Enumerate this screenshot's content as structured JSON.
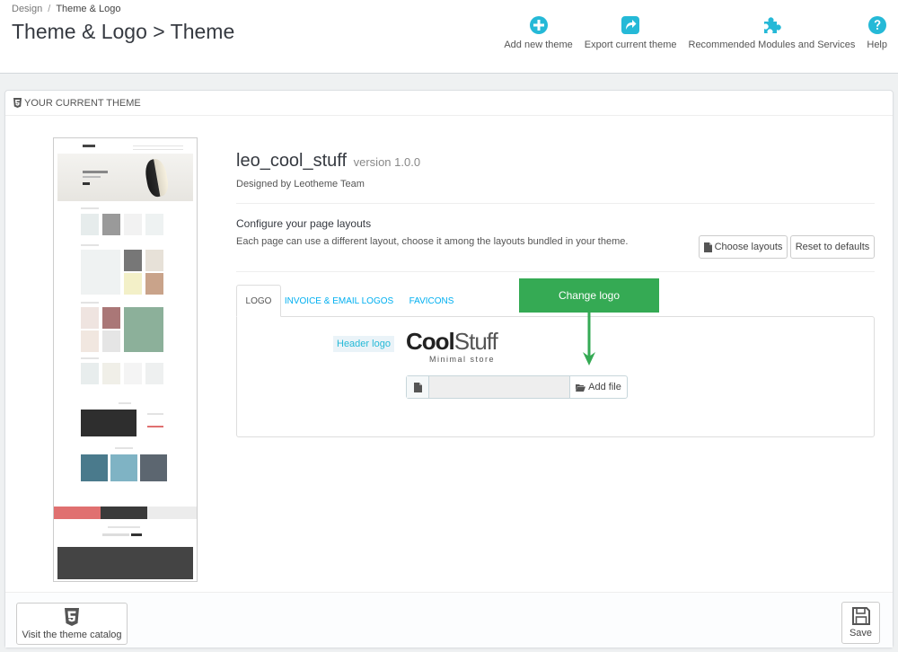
{
  "breadcrumb": {
    "parent": "Design",
    "separator": "/",
    "current": "Theme & Logo"
  },
  "page_title": "Theme & Logo > Theme",
  "toolbar": [
    {
      "label": "Add new theme",
      "icon": "plus-circle-icon"
    },
    {
      "label": "Export current theme",
      "icon": "share-icon"
    },
    {
      "label": "Recommended Modules and Services",
      "icon": "puzzle-icon"
    },
    {
      "label": "Help",
      "icon": "help-icon"
    }
  ],
  "panel": {
    "heading": "YOUR CURRENT THEME"
  },
  "theme": {
    "name": "leo_cool_stuff",
    "version": "version 1.0.0",
    "designed_by": "Designed by Leotheme Team"
  },
  "layouts": {
    "title": "Configure your page layouts",
    "description": "Each page can use a different layout, choose it among the layouts bundled in your theme.",
    "choose_label": "Choose layouts",
    "reset_label": "Reset to defaults"
  },
  "tabs": [
    {
      "label": "LOGO",
      "active": true
    },
    {
      "label": "INVOICE & EMAIL LOGOS",
      "active": false
    },
    {
      "label": "FAVICONS",
      "active": false
    }
  ],
  "logo_tab": {
    "header_logo_label": "Header logo",
    "logo_text_bold": "Cool",
    "logo_text_light": "Stuff",
    "logo_tagline": "Minimal store",
    "file_value": "",
    "add_file_label": "Add file"
  },
  "annotation": {
    "text": "Change logo",
    "color": "#35aa54"
  },
  "footer": {
    "catalog_label": "Visit the theme catalog",
    "save_label": "Save"
  },
  "colors": {
    "accent": "#25b9d7",
    "link": "#00aff0",
    "callout": "#35aa54"
  }
}
